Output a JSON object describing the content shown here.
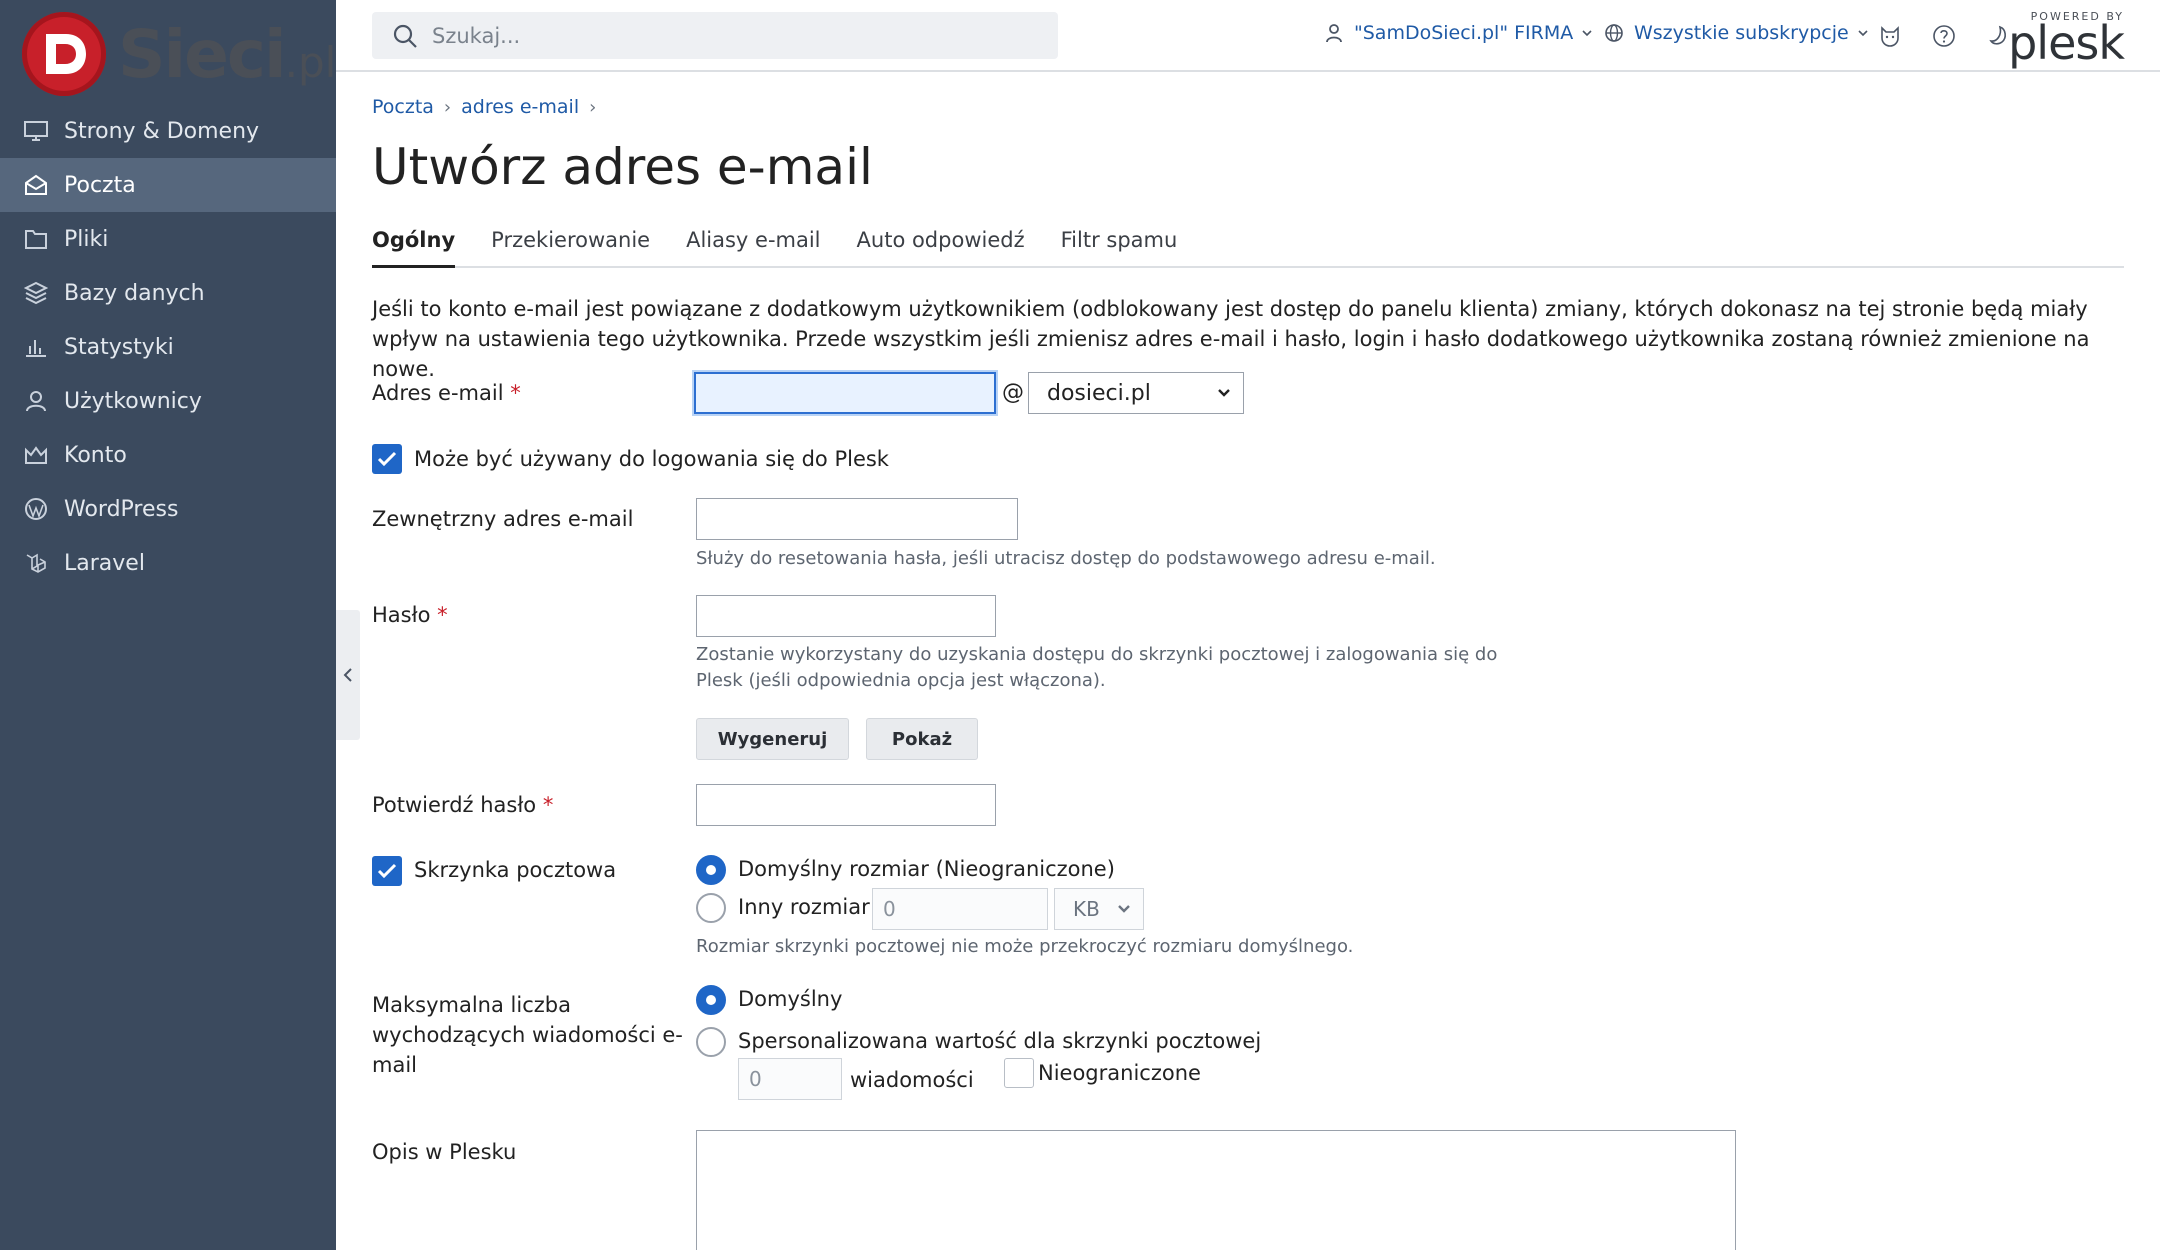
{
  "brand": {
    "logo_text": "Sieci",
    "logo_tld": ".pl",
    "powered_by": "POWERED BY",
    "platform": "plesk"
  },
  "sidebar": {
    "items": [
      {
        "label": "Strony & Domeny",
        "icon": "monitor-icon",
        "active": false
      },
      {
        "label": "Poczta",
        "icon": "mail-icon",
        "active": true
      },
      {
        "label": "Pliki",
        "icon": "folder-icon",
        "active": false
      },
      {
        "label": "Bazy danych",
        "icon": "database-icon",
        "active": false
      },
      {
        "label": "Statystyki",
        "icon": "bar-chart-icon",
        "active": false
      },
      {
        "label": "Użytkownicy",
        "icon": "user-icon",
        "active": false
      },
      {
        "label": "Konto",
        "icon": "crown-icon",
        "active": false
      },
      {
        "label": "WordPress",
        "icon": "wordpress-icon",
        "active": false
      },
      {
        "label": "Laravel",
        "icon": "laravel-icon",
        "active": false
      }
    ]
  },
  "header": {
    "search_placeholder": "Szukaj...",
    "account_label": "\"SamDoSieci.pl\" FIRMA",
    "subscriptions_label": "Wszystkie subskrypcje"
  },
  "breadcrumb": [
    "Poczta",
    "adres e-mail"
  ],
  "page_title": "Utwórz adres e-mail",
  "tabs": [
    "Ogólny",
    "Przekierowanie",
    "Aliasy e-mail",
    "Auto odpowiedź",
    "Filtr spamu"
  ],
  "intro": "Jeśli to konto e-mail jest powiązane z dodatkowym użytkownikiem (odblokowany jest dostęp do panelu klienta) zmiany, których dokonasz na tej stronie będą miały wpływ na ustawienia tego użytkownika. Przede wszystkim jeśli zmienisz adres e-mail i hasło, login i hasło dodatkowego użytkownika zostaną również zmienione na nowe.",
  "form": {
    "email_label": "Adres e-mail",
    "email_value": "",
    "at_sign": "@",
    "domain_value": "dosieci.pl",
    "login_checkbox_label": "Może być używany do logowania się do Plesk",
    "login_checked": true,
    "external_email_label": "Zewnętrzny adres e-mail",
    "external_email_hint": "Służy do resetowania hasła, jeśli utracisz dostęp do podstawowego adresu e-mail.",
    "password_label": "Hasło",
    "password_hint_line1": "Zostanie wykorzystany do uzyskania dostępu do skrzynki pocztowej i zalogowania się do",
    "password_hint_line2": "Plesk (jeśli odpowiednia opcja jest włączona).",
    "generate_button": "Wygeneruj",
    "show_button": "Pokaż",
    "confirm_password_label": "Potwierdź hasło",
    "mailbox_label": "Skrzynka pocztowa",
    "mailbox_checked": true,
    "mailbox_default_size": "Domyślny rozmiar (Nieograniczone)",
    "mailbox_other_size": "Inny rozmiar",
    "mailbox_size_value": "0",
    "mailbox_size_unit": "KB",
    "mailbox_hint": "Rozmiar skrzynki pocztowej nie może przekroczyć rozmiaru domyślnego.",
    "max_outgoing_label_line1": "Maksymalna liczba",
    "max_outgoing_label_line2": "wychodzących wiadomości e-",
    "max_outgoing_label_line3": "mail",
    "outgoing_default": "Domyślny",
    "outgoing_custom": "Spersonalizowana wartość dla skrzynki pocztowej",
    "outgoing_value": "0",
    "outgoing_unit": "wiadomości",
    "outgoing_unlimited": "Nieograniczone",
    "description_label": "Opis w Plesku"
  },
  "colors": {
    "sidebar_bg": "#3b4a5e",
    "sidebar_active": "#56677d",
    "link": "#1f5aa6",
    "accent": "#1f66c7",
    "required": "#c8202a"
  }
}
